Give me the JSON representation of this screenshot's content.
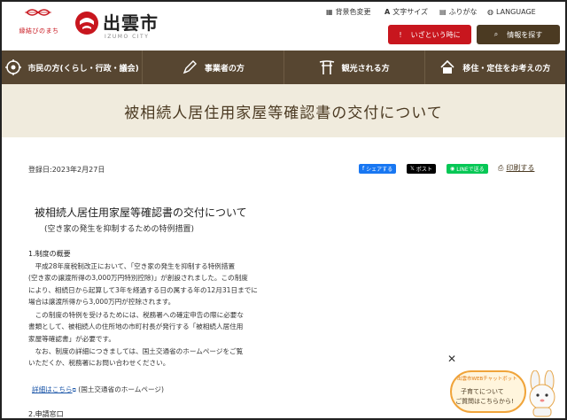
{
  "header": {
    "slogan": "縁結びのまち",
    "city_name": "出雲市",
    "city_name_en": "IZUMO CITY",
    "utility": [
      {
        "icon": "palette-icon",
        "label": "背景色変更"
      },
      {
        "icon": "text-size-icon",
        "label": "文字サイズ"
      },
      {
        "icon": "furigana-icon",
        "label": "ふりがな"
      },
      {
        "icon": "globe-icon",
        "label": "LANGUAGE"
      }
    ],
    "emergency_label": "いざという時に",
    "search_label": "情報を探す"
  },
  "nav": [
    {
      "icon": "gear-icon",
      "label": "市民の方(くらし・行政・議会)"
    },
    {
      "icon": "pen-icon",
      "label": "事業者の方"
    },
    {
      "icon": "torii-icon",
      "label": "観光される方"
    },
    {
      "icon": "house-icon",
      "label": "移住・定住をお考えの方"
    }
  ],
  "banner_title": "被相続人居住用家屋等確認書の交付について",
  "article": {
    "date": "登録日:2023年2月27日",
    "share_facebook": "シェアする",
    "share_x": "ポスト",
    "share_line": "LINEで送る",
    "print": "印刷する",
    "title": "被相続人居住用家屋等確認書の交付について",
    "subtitle": "(空き家の発生を抑制するための特例措置)",
    "section1": "1.制度の概要",
    "para1": [
      "　平成28年度税制改正において、「空き家の発生を抑制する特例措置",
      "(空き家の譲渡所得の3,000万円特別控除)」が創設されました。この制度",
      "により、相続日から起算して3年を経過する日の属する年の12月31日までに",
      "場合は譲渡所得から3,000万円が控除されます。"
    ],
    "para2": [
      "　この制度の特例を受けるためには、税務署への確定申告の際に必要な",
      "書類として、被相続人の住所地の市町村長が発行する「被相続人居住用",
      "家屋等確認書」が必要です。"
    ],
    "para3": [
      "　なお、制度の詳細につきましては、国土交通省のホームページをご覧",
      "いただくか、税務署にお問い合わせください。"
    ],
    "link_text": "詳細はこちら",
    "link_suffix": "(国土交通省のホームページ)",
    "section2": "2.申請窓口"
  },
  "chatbot": {
    "heading": "出雲市WEBチャットボット",
    "line1": "子育てについて",
    "line2": "ご質問はこちらから!"
  },
  "colors": {
    "brand_red": "#c8161e",
    "brand_brown": "#574631",
    "banner_bg": "#f0ebdd"
  }
}
